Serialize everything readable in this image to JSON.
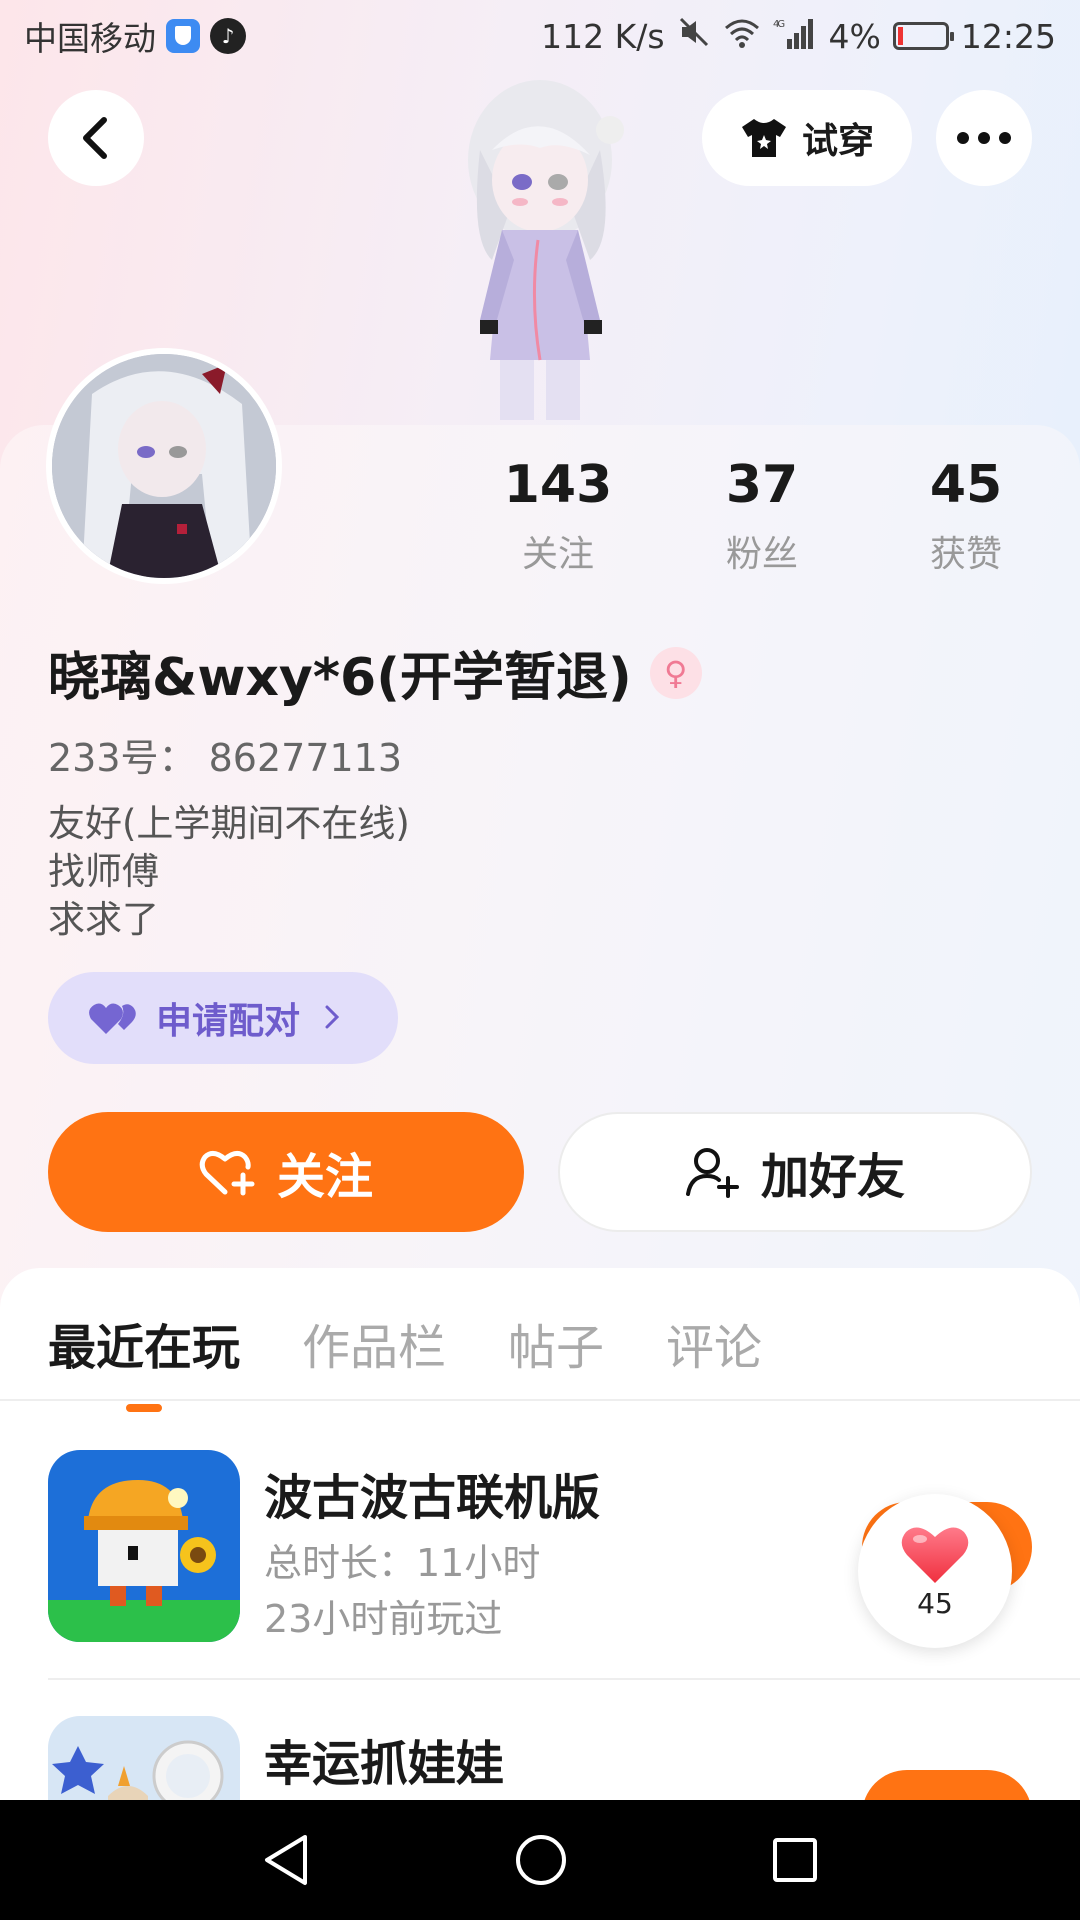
{
  "status_bar": {
    "carrier": "中国移动",
    "speed": "112 K/s",
    "network": "4G",
    "battery": "4%",
    "time": "12:25"
  },
  "header": {
    "try_on_label": "试穿"
  },
  "profile": {
    "stats": [
      {
        "num": "143",
        "label": "关注"
      },
      {
        "num": "37",
        "label": "粉丝"
      },
      {
        "num": "45",
        "label": "获赞"
      }
    ],
    "name": "晓璃&wxy*6(开学暂退)",
    "uid": "233号： 86277113",
    "bio_lines": [
      "友好(上学期间不在线)",
      "找师傅",
      "求求了"
    ],
    "pair_label": "申请配对"
  },
  "actions": {
    "follow_label": "关注",
    "add_friend_label": "加好友"
  },
  "tabs": [
    "最近在玩",
    "作品栏",
    "帖子",
    "评论"
  ],
  "games": [
    {
      "title": "波古波古联机版",
      "duration": "总时长：11小时",
      "last_played": "23小时前玩过"
    },
    {
      "title": "幸运抓娃娃"
    }
  ],
  "like_float": {
    "count": "45"
  },
  "colors": {
    "accent": "#ff7313",
    "pair": "#6e5ccc"
  }
}
